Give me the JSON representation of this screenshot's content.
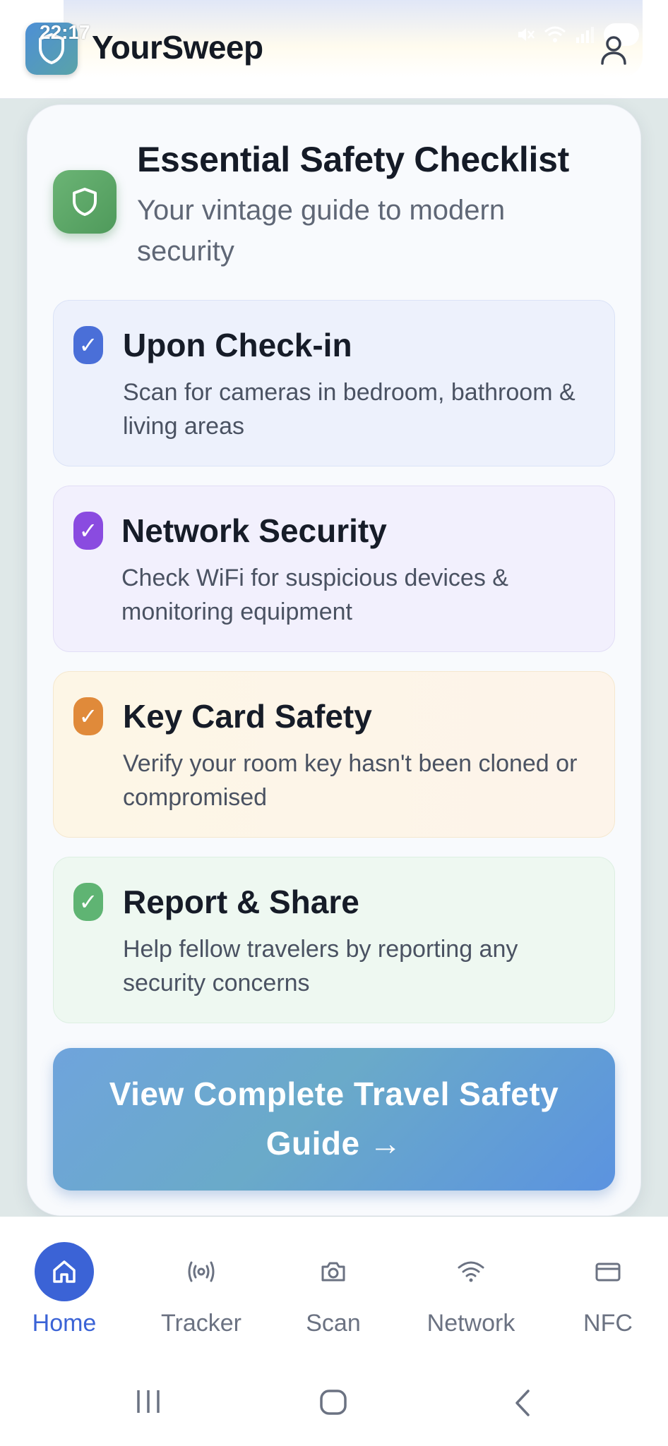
{
  "status_bar": {
    "time": "22:17"
  },
  "header": {
    "app_name": "YourSweep",
    "logo_icon": "shield-logo-icon",
    "profile_icon": "user-icon"
  },
  "checklist": {
    "title": "Essential Safety Checklist",
    "subtitle": "Your vintage guide to modern security",
    "items": [
      {
        "check": "✓",
        "title": "Upon Check-in",
        "description": "Scan for cameras in bedroom, bathroom & living areas",
        "accent": "#4a6fd8"
      },
      {
        "check": "✓",
        "title": "Network Security",
        "description": "Check WiFi for suspicious devices & monitoring equipment",
        "accent": "#8a4be0"
      },
      {
        "check": "✓",
        "title": "Key Card Safety",
        "description": "Verify your room key hasn't been cloned or compromised",
        "accent": "#e08a3a"
      },
      {
        "check": "✓",
        "title": "Report & Share",
        "description": "Help fellow travelers by reporting any security concerns",
        "accent": "#5fb473"
      }
    ],
    "cta_label": "View Complete Travel Safety Guide →"
  },
  "bottom_nav": {
    "items": [
      {
        "label": "Home",
        "icon": "home-icon",
        "active": true
      },
      {
        "label": "Tracker",
        "icon": "broadcast-icon",
        "active": false
      },
      {
        "label": "Scan",
        "icon": "camera-icon",
        "active": false
      },
      {
        "label": "Network",
        "icon": "wifi-icon",
        "active": false
      },
      {
        "label": "NFC",
        "icon": "card-icon",
        "active": false
      }
    ],
    "active_color": "#3b63d6"
  },
  "system_nav": {
    "recent_icon": "recent-apps-icon",
    "home_icon": "system-home-icon",
    "back_icon": "back-icon"
  }
}
